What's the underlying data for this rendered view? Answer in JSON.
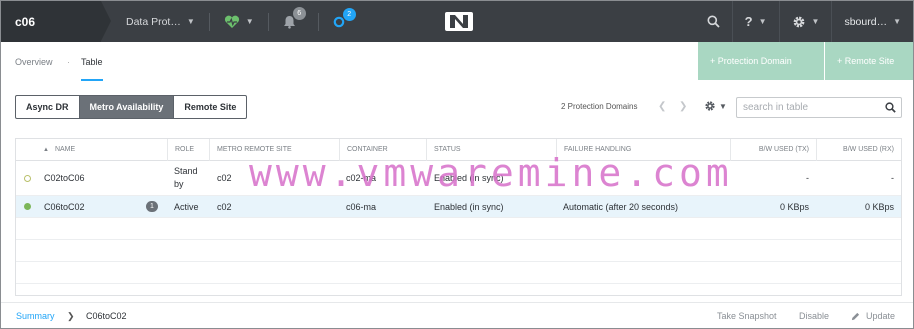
{
  "header": {
    "cluster_name": "c06",
    "dashboard_label": "Data Prot…",
    "alerts_count": "6",
    "tasks_count": "2",
    "user_label": "sbourd…"
  },
  "subnav": {
    "tabs": [
      {
        "label": "Overview"
      },
      {
        "label": "Table"
      }
    ],
    "active_tab": "Table",
    "separator": "·",
    "actions": {
      "protection_domain": "+ Protection Domain",
      "remote_site": "+ Remote Site"
    }
  },
  "filters": {
    "segments": [
      {
        "label": "Async DR"
      },
      {
        "label": "Metro Availability"
      },
      {
        "label": "Remote Site"
      }
    ],
    "active_segment": "Metro Availability",
    "count_text": "2 Protection Domains",
    "search_placeholder": "search in table"
  },
  "table": {
    "columns": [
      {
        "label": "NAME",
        "sorted": "asc"
      },
      {
        "label": "ROLE"
      },
      {
        "label": "METRO REMOTE SITE"
      },
      {
        "label": "CONTAINER"
      },
      {
        "label": "STATUS"
      },
      {
        "label": "FAILURE HANDLING"
      },
      {
        "label": "B/W USED (TX)"
      },
      {
        "label": "B/W USED (RX)"
      }
    ],
    "rows": [
      {
        "name": "C02toC06",
        "badge": "",
        "role": "Stand by",
        "remote_site": "c02",
        "container": "c02-ma",
        "status": "Enabled (in sync)",
        "failure_handling": "",
        "bw_tx": "-",
        "bw_rx": "-",
        "state": "idle"
      },
      {
        "name": "C06toC02",
        "badge": "1",
        "role": "Active",
        "remote_site": "c02",
        "container": "c06-ma",
        "status": "Enabled (in sync)",
        "failure_handling": "Automatic (after 20 seconds)",
        "bw_tx": "0 KBps",
        "bw_rx": "0 KBps",
        "state": "ok"
      }
    ]
  },
  "footer": {
    "summary_link": "Summary",
    "selected": "C06toC02",
    "actions": {
      "take_snapshot": "Take Snapshot",
      "disable": "Disable",
      "update": "Update"
    }
  },
  "watermark": "www.vmwaremine.com",
  "colors": {
    "accent": "#22a5f7",
    "topbar": "#3b3f44",
    "action_button": "#a9d7c2",
    "status_ok": "#7cb659"
  }
}
